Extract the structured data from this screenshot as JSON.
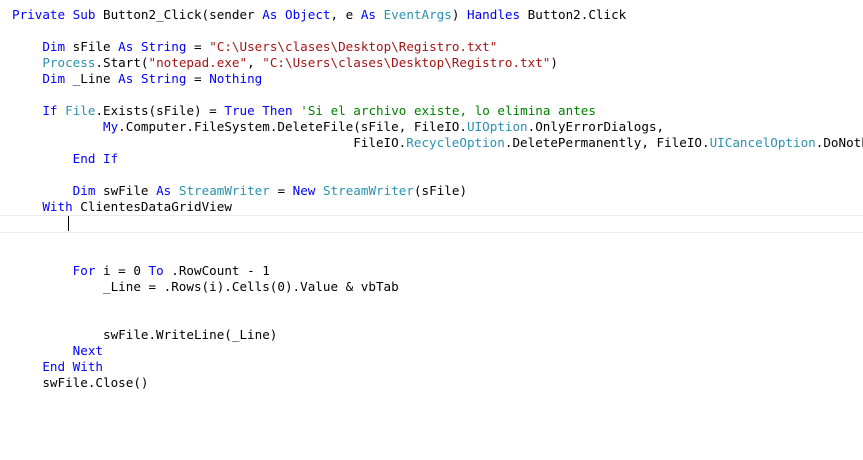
{
  "code": {
    "lines": [
      {
        "tokens": [
          {
            "t": "Private Sub",
            "c": "kw"
          },
          {
            "t": " Button2_Click(sender ",
            "c": "plain"
          },
          {
            "t": "As",
            "c": "kw"
          },
          {
            "t": " ",
            "c": "plain"
          },
          {
            "t": "Object",
            "c": "kw"
          },
          {
            "t": ", e ",
            "c": "plain"
          },
          {
            "t": "As",
            "c": "kw"
          },
          {
            "t": " ",
            "c": "plain"
          },
          {
            "t": "EventArgs",
            "c": "ty"
          },
          {
            "t": ") ",
            "c": "plain"
          },
          {
            "t": "Handles",
            "c": "kw"
          },
          {
            "t": " Button2.Click",
            "c": "plain"
          }
        ]
      },
      {
        "tokens": []
      },
      {
        "tokens": [
          {
            "t": "    ",
            "c": "plain"
          },
          {
            "t": "Dim",
            "c": "kw"
          },
          {
            "t": " sFile ",
            "c": "plain"
          },
          {
            "t": "As",
            "c": "kw"
          },
          {
            "t": " ",
            "c": "plain"
          },
          {
            "t": "String",
            "c": "kw"
          },
          {
            "t": " = ",
            "c": "plain"
          },
          {
            "t": "\"C:\\Users\\clases\\Desktop\\Registro.txt\"",
            "c": "str"
          }
        ]
      },
      {
        "tokens": [
          {
            "t": "    ",
            "c": "plain"
          },
          {
            "t": "Process",
            "c": "ty"
          },
          {
            "t": ".Start(",
            "c": "plain"
          },
          {
            "t": "\"notepad.exe\"",
            "c": "str"
          },
          {
            "t": ", ",
            "c": "plain"
          },
          {
            "t": "\"C:\\Users\\clases\\Desktop\\Registro.txt\"",
            "c": "str"
          },
          {
            "t": ")",
            "c": "plain"
          }
        ]
      },
      {
        "tokens": [
          {
            "t": "    ",
            "c": "plain"
          },
          {
            "t": "Dim",
            "c": "kw"
          },
          {
            "t": " _Line ",
            "c": "plain"
          },
          {
            "t": "As",
            "c": "kw"
          },
          {
            "t": " ",
            "c": "plain"
          },
          {
            "t": "String",
            "c": "kw"
          },
          {
            "t": " = ",
            "c": "plain"
          },
          {
            "t": "Nothing",
            "c": "kw"
          }
        ]
      },
      {
        "tokens": []
      },
      {
        "tokens": [
          {
            "t": "    ",
            "c": "plain"
          },
          {
            "t": "If",
            "c": "kw"
          },
          {
            "t": " ",
            "c": "plain"
          },
          {
            "t": "File",
            "c": "ty"
          },
          {
            "t": ".Exists(sFile) = ",
            "c": "plain"
          },
          {
            "t": "True",
            "c": "kw"
          },
          {
            "t": " ",
            "c": "plain"
          },
          {
            "t": "Then",
            "c": "kw"
          },
          {
            "t": " ",
            "c": "plain"
          },
          {
            "t": "'Si el archivo existe, lo elimina antes",
            "c": "cm"
          }
        ]
      },
      {
        "tokens": [
          {
            "t": "            ",
            "c": "plain"
          },
          {
            "t": "My",
            "c": "kw"
          },
          {
            "t": ".Computer.FileSystem.DeleteFile(sFile, FileIO.",
            "c": "plain"
          },
          {
            "t": "UIOption",
            "c": "ty"
          },
          {
            "t": ".OnlyErrorDialogs,",
            "c": "plain"
          }
        ]
      },
      {
        "tokens": [
          {
            "t": "                                             FileIO.",
            "c": "plain"
          },
          {
            "t": "RecycleOption",
            "c": "ty"
          },
          {
            "t": ".DeletePermanently, FileIO.",
            "c": "plain"
          },
          {
            "t": "UICancelOption",
            "c": "ty"
          },
          {
            "t": ".DoNothing)",
            "c": "plain"
          }
        ]
      },
      {
        "tokens": [
          {
            "t": "        ",
            "c": "plain"
          },
          {
            "t": "End If",
            "c": "kw"
          }
        ]
      },
      {
        "tokens": []
      },
      {
        "tokens": [
          {
            "t": "        ",
            "c": "plain"
          },
          {
            "t": "Dim",
            "c": "kw"
          },
          {
            "t": " swFile ",
            "c": "plain"
          },
          {
            "t": "As",
            "c": "kw"
          },
          {
            "t": " ",
            "c": "plain"
          },
          {
            "t": "StreamWriter",
            "c": "ty"
          },
          {
            "t": " = ",
            "c": "plain"
          },
          {
            "t": "New",
            "c": "kw"
          },
          {
            "t": " ",
            "c": "plain"
          },
          {
            "t": "StreamWriter",
            "c": "ty"
          },
          {
            "t": "(sFile)",
            "c": "plain"
          }
        ]
      },
      {
        "tokens": [
          {
            "t": "    ",
            "c": "plain"
          },
          {
            "t": "With",
            "c": "kw"
          },
          {
            "t": " ClientesDataGridView",
            "c": "plain"
          }
        ]
      },
      {
        "tokens": []
      },
      {
        "tokens": []
      },
      {
        "tokens": []
      },
      {
        "tokens": [
          {
            "t": "        ",
            "c": "plain"
          },
          {
            "t": "For",
            "c": "kw"
          },
          {
            "t": " i = 0 ",
            "c": "plain"
          },
          {
            "t": "To",
            "c": "kw"
          },
          {
            "t": " .RowCount - 1",
            "c": "plain"
          }
        ]
      },
      {
        "tokens": [
          {
            "t": "            _Line = .Rows(i).Cells(0).Value & vbTab",
            "c": "plain"
          }
        ]
      },
      {
        "tokens": []
      },
      {
        "tokens": []
      },
      {
        "tokens": [
          {
            "t": "            swFile.WriteLine(_Line)",
            "c": "plain"
          }
        ]
      },
      {
        "tokens": [
          {
            "t": "        ",
            "c": "plain"
          },
          {
            "t": "Next",
            "c": "kw"
          }
        ]
      },
      {
        "tokens": [
          {
            "t": "    ",
            "c": "plain"
          },
          {
            "t": "End With",
            "c": "kw"
          }
        ]
      },
      {
        "tokens": [
          {
            "t": "    swFile.Close()",
            "c": "plain"
          }
        ]
      }
    ]
  },
  "colors": {
    "keyword": "#0000ff",
    "string": "#a31515",
    "type": "#2b91af",
    "comment": "#008000",
    "text": "#000000",
    "background": "#ffffff"
  }
}
